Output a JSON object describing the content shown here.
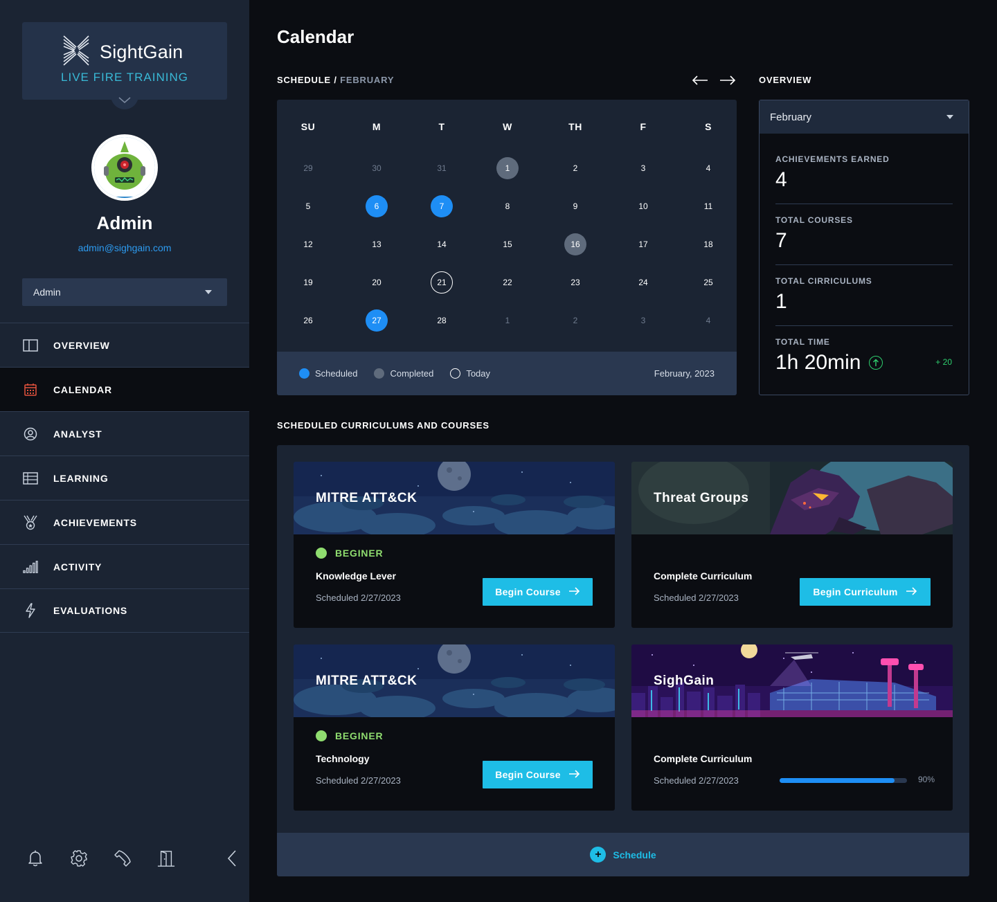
{
  "brand": {
    "name": "SightGain",
    "tagline": "LIVE FIRE TRAINING",
    "accent": "#39b9d6"
  },
  "user": {
    "name": "Admin",
    "email": "admin@sighgain.com",
    "role": "Admin"
  },
  "nav": [
    {
      "label": "OVERVIEW",
      "icon": "columns-icon",
      "active": false
    },
    {
      "label": "CALENDAR",
      "icon": "calendar-icon",
      "active": true
    },
    {
      "label": "ANALYST",
      "icon": "user-circle-icon",
      "active": false
    },
    {
      "label": "LEARNING",
      "icon": "table-icon",
      "active": false
    },
    {
      "label": "ACHIEVEMENTS",
      "icon": "medal-icon",
      "active": false
    },
    {
      "label": "ACTIVITY",
      "icon": "signal-bars-icon",
      "active": false
    },
    {
      "label": "EVALUATIONS",
      "icon": "lightning-icon",
      "active": false
    }
  ],
  "footer_icons": [
    "bell-icon",
    "gear-icon",
    "phone-icon",
    "door-icon",
    "chevron-left-icon"
  ],
  "page": {
    "title": "Calendar"
  },
  "schedule": {
    "label": "SCHEDULE",
    "separator": " / ",
    "month": "FEBRUARY"
  },
  "calendar": {
    "weekdays": [
      "SU",
      "M",
      "T",
      "W",
      "TH",
      "F",
      "S"
    ],
    "weeks": [
      [
        {
          "d": "29",
          "m": true
        },
        {
          "d": "30",
          "m": true
        },
        {
          "d": "31",
          "m": true
        },
        {
          "d": "1",
          "s": "completed"
        },
        {
          "d": "2"
        },
        {
          "d": "3"
        },
        {
          "d": "4"
        }
      ],
      [
        {
          "d": "5"
        },
        {
          "d": "6",
          "s": "scheduled"
        },
        {
          "d": "7",
          "s": "scheduled"
        },
        {
          "d": "8"
        },
        {
          "d": "9"
        },
        {
          "d": "10"
        },
        {
          "d": "11"
        }
      ],
      [
        {
          "d": "12"
        },
        {
          "d": "13"
        },
        {
          "d": "14"
        },
        {
          "d": "15"
        },
        {
          "d": "16",
          "s": "completed"
        },
        {
          "d": "17"
        },
        {
          "d": "18"
        }
      ],
      [
        {
          "d": "19"
        },
        {
          "d": "20"
        },
        {
          "d": "21",
          "s": "today"
        },
        {
          "d": "22"
        },
        {
          "d": "23"
        },
        {
          "d": "24"
        },
        {
          "d": "25"
        }
      ],
      [
        {
          "d": "26"
        },
        {
          "d": "27",
          "s": "scheduled"
        },
        {
          "d": "28"
        },
        {
          "d": "1",
          "m": true
        },
        {
          "d": "2",
          "m": true
        },
        {
          "d": "3",
          "m": true
        },
        {
          "d": "4",
          "m": true
        }
      ]
    ],
    "legend": {
      "scheduled": "Scheduled",
      "completed": "Completed",
      "today": "Today"
    },
    "footer_date": "February, 2023",
    "colors": {
      "scheduled": "#1e8ef5",
      "completed": "#5f6b7c"
    }
  },
  "overview": {
    "heading": "OVERVIEW",
    "month": "February",
    "stats": [
      {
        "label": "ACHIEVEMENTS EARNED",
        "value": "4"
      },
      {
        "label": "TOTAL COURSES",
        "value": "7"
      },
      {
        "label": "TOTAL CIRRICULUMS",
        "value": "1"
      },
      {
        "label": "TOTAL TIME",
        "value": "1h 20min",
        "delta": "+ 20"
      }
    ]
  },
  "courses": {
    "heading": "SCHEDULED CURRICULUMS AND COURSES",
    "items": [
      {
        "title": "MITRE ATT&CK",
        "level": "BEGINER",
        "name": "Knowledge Lever",
        "date": "Scheduled 2/27/2023",
        "button": "Begin Course",
        "banner": "night-clouds"
      },
      {
        "title": "Threat Groups",
        "name": "Complete Curriculum",
        "date": "Scheduled 2/27/2023",
        "button": "Begin Curriculum",
        "banner": "monster"
      },
      {
        "title": "MITRE ATT&CK",
        "level": "BEGINER",
        "name": "Technology",
        "date": "Scheduled 2/27/2023",
        "button": "Begin Course",
        "banner": "night-clouds"
      },
      {
        "title": "SighGain",
        "name": "Complete Curriculum",
        "date": "Scheduled 2/27/2023",
        "progress": 0.9,
        "progress_label": "90%",
        "banner": "neon-city"
      }
    ],
    "schedule_button": "Schedule"
  }
}
